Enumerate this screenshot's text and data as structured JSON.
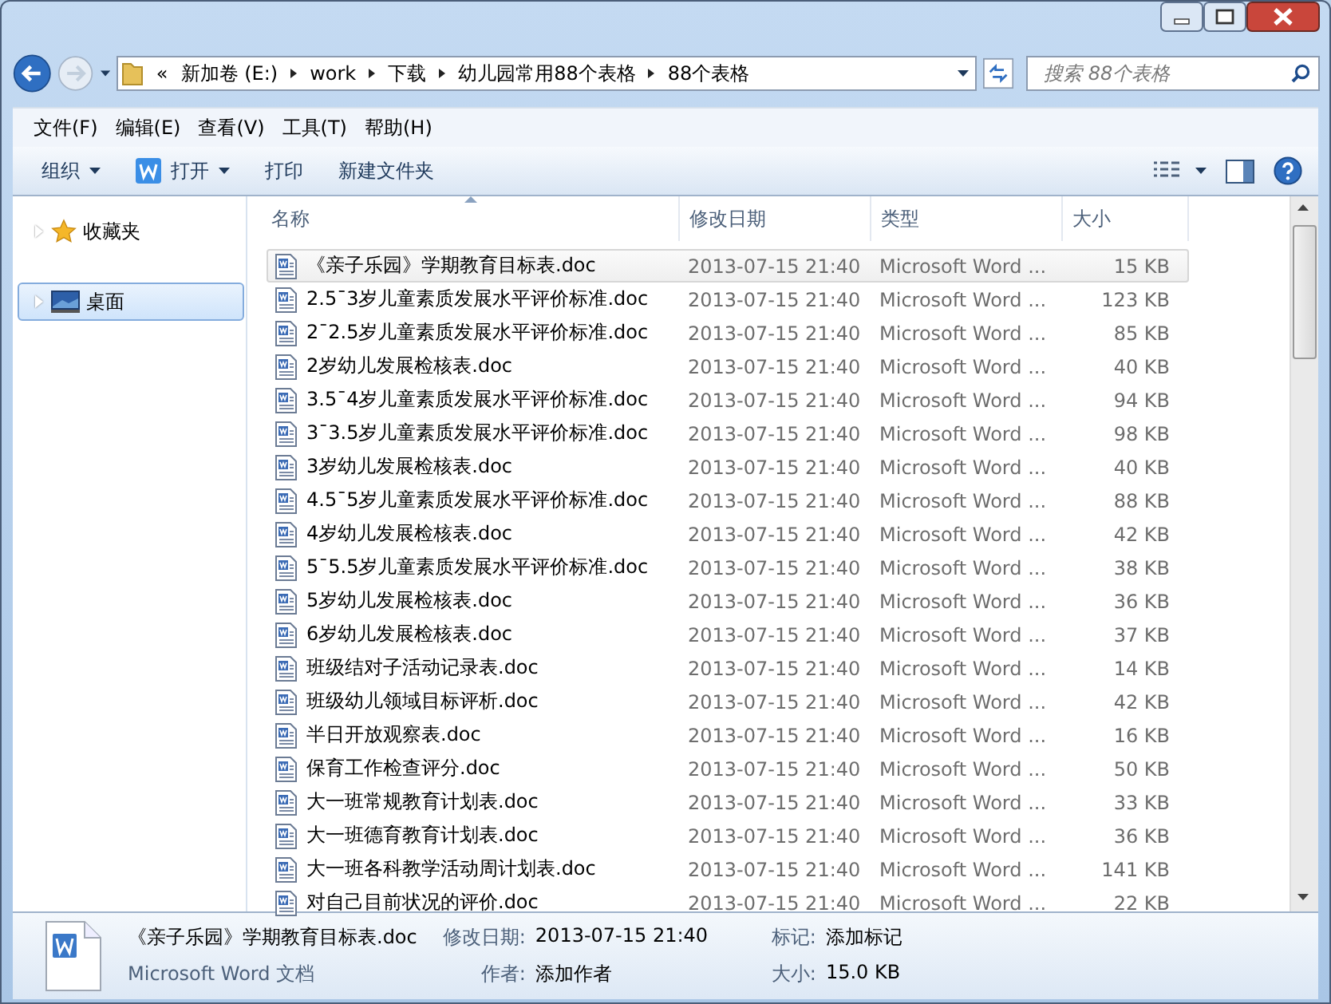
{
  "address": {
    "overflow": "«",
    "breadcrumbs": [
      "新加卷 (E:)",
      "work",
      "下载",
      "幼儿园常用88个表格",
      "88个表格"
    ]
  },
  "search": {
    "placeholder": "搜索 88个表格"
  },
  "menu": [
    "文件(F)",
    "编辑(E)",
    "查看(V)",
    "工具(T)",
    "帮助(H)"
  ],
  "toolbar": [
    {
      "label": "组织",
      "kind": "plain",
      "dropdown": true
    },
    {
      "label": "打开",
      "kind": "word",
      "dropdown": true
    },
    {
      "label": "打印",
      "kind": "plain",
      "dropdown": false
    },
    {
      "label": "新建文件夹",
      "kind": "plain",
      "dropdown": false
    }
  ],
  "sidebar": {
    "items": [
      {
        "label": "收藏夹",
        "kind": "favorites",
        "selected": false
      },
      {
        "label": "桌面",
        "kind": "desktop",
        "selected": true
      }
    ]
  },
  "table": {
    "columns": [
      {
        "label": "名称",
        "sorted": true
      },
      {
        "label": "修改日期",
        "sorted": false
      },
      {
        "label": "类型",
        "sorted": false
      },
      {
        "label": "大小",
        "sorted": false
      }
    ],
    "rows": [
      {
        "name": "《亲子乐园》学期教育目标表.doc",
        "date": "2013-07-15 21:40",
        "type": "Microsoft Word ...",
        "size": "15 KB",
        "selected": true
      },
      {
        "name": "2.5¯3岁儿童素质发展水平评价标准.doc",
        "date": "2013-07-15 21:40",
        "type": "Microsoft Word ...",
        "size": "123 KB",
        "selected": false
      },
      {
        "name": "2¯2.5岁儿童素质发展水平评价标准.doc",
        "date": "2013-07-15 21:40",
        "type": "Microsoft Word ...",
        "size": "85 KB",
        "selected": false
      },
      {
        "name": "2岁幼儿发展检核表.doc",
        "date": "2013-07-15 21:40",
        "type": "Microsoft Word ...",
        "size": "40 KB",
        "selected": false
      },
      {
        "name": "3.5¯4岁儿童素质发展水平评价标准.doc",
        "date": "2013-07-15 21:40",
        "type": "Microsoft Word ...",
        "size": "94 KB",
        "selected": false
      },
      {
        "name": "3¯3.5岁儿童素质发展水平评价标准.doc",
        "date": "2013-07-15 21:40",
        "type": "Microsoft Word ...",
        "size": "98 KB",
        "selected": false
      },
      {
        "name": "3岁幼儿发展检核表.doc",
        "date": "2013-07-15 21:40",
        "type": "Microsoft Word ...",
        "size": "40 KB",
        "selected": false
      },
      {
        "name": "4.5¯5岁儿童素质发展水平评价标准.doc",
        "date": "2013-07-15 21:40",
        "type": "Microsoft Word ...",
        "size": "88 KB",
        "selected": false
      },
      {
        "name": "4岁幼儿发展检核表.doc",
        "date": "2013-07-15 21:40",
        "type": "Microsoft Word ...",
        "size": "42 KB",
        "selected": false
      },
      {
        "name": "5¯5.5岁儿童素质发展水平评价标准.doc",
        "date": "2013-07-15 21:40",
        "type": "Microsoft Word ...",
        "size": "38 KB",
        "selected": false
      },
      {
        "name": "5岁幼儿发展检核表.doc",
        "date": "2013-07-15 21:40",
        "type": "Microsoft Word ...",
        "size": "36 KB",
        "selected": false
      },
      {
        "name": "6岁幼儿发展检核表.doc",
        "date": "2013-07-15 21:40",
        "type": "Microsoft Word ...",
        "size": "37 KB",
        "selected": false
      },
      {
        "name": "班级结对子活动记录表.doc",
        "date": "2013-07-15 21:40",
        "type": "Microsoft Word ...",
        "size": "14 KB",
        "selected": false
      },
      {
        "name": "班级幼儿领域目标评析.doc",
        "date": "2013-07-15 21:40",
        "type": "Microsoft Word ...",
        "size": "42 KB",
        "selected": false
      },
      {
        "name": "半日开放观察表.doc",
        "date": "2013-07-15 21:40",
        "type": "Microsoft Word ...",
        "size": "16 KB",
        "selected": false
      },
      {
        "name": "保育工作检查评分.doc",
        "date": "2013-07-15 21:40",
        "type": "Microsoft Word ...",
        "size": "50 KB",
        "selected": false
      },
      {
        "name": "大一班常规教育计划表.doc",
        "date": "2013-07-15 21:40",
        "type": "Microsoft Word ...",
        "size": "33 KB",
        "selected": false
      },
      {
        "name": "大一班德育教育计划表.doc",
        "date": "2013-07-15 21:40",
        "type": "Microsoft Word ...",
        "size": "36 KB",
        "selected": false
      },
      {
        "name": "大一班各科教学活动周计划表.doc",
        "date": "2013-07-15 21:40",
        "type": "Microsoft Word ...",
        "size": "141 KB",
        "selected": false
      },
      {
        "name": "对自己目前状况的评价.doc",
        "date": "2013-07-15 21:40",
        "type": "Microsoft Word ...",
        "size": "22 KB",
        "selected": false
      }
    ]
  },
  "details": {
    "name": "《亲子乐园》学期教育目标表.doc",
    "type": "Microsoft Word 文档",
    "fields": [
      {
        "label": "修改日期:",
        "value": "2013-07-15 21:40"
      },
      {
        "label": "标记:",
        "value": "添加标记"
      },
      {
        "label": "作者:",
        "value": "添加作者"
      },
      {
        "label": "大小:",
        "value": "15.0 KB"
      }
    ]
  }
}
